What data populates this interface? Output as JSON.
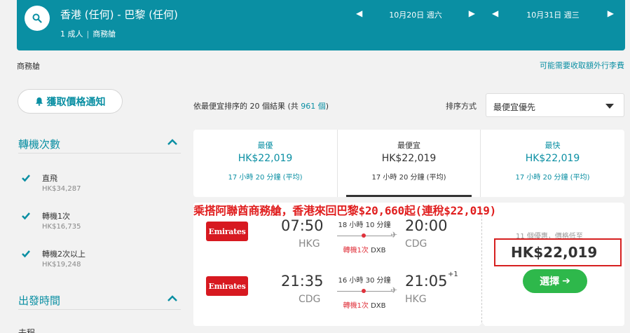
{
  "search": {
    "route": "香港 (任何) - 巴黎 (任何)",
    "passengers": "1 成人",
    "cabin": "商務艙",
    "depart_date": "10月20日 週六",
    "return_date": "10月31日 週三"
  },
  "subheader": {
    "cabin_label": "商務艙",
    "baggage_link": "可能需要收取額外行李費"
  },
  "sidebar": {
    "alert_button": "獲取價格通知",
    "stops_title": "轉機次數",
    "stops": [
      {
        "label": "直飛",
        "price": "HK$34,287",
        "checked": true
      },
      {
        "label": "轉機1次",
        "price": "HK$16,735",
        "checked": true
      },
      {
        "label": "轉機2次以上",
        "price": "HK$19,248",
        "checked": true
      }
    ],
    "departure_title": "出發時間",
    "cut_label": "去程"
  },
  "results": {
    "count_prefix": "依最便宜排序的 20 個結果 (共 ",
    "count_total": "961 個",
    "count_suffix": ")",
    "sort_label": "排序方式",
    "sort_value": "最便宜優先"
  },
  "summary": [
    {
      "title": "最優",
      "price": "HK$22,019",
      "duration": "17 小時 20 分鐘 (平均)"
    },
    {
      "title": "最便宜",
      "price": "HK$22,019",
      "duration": "17 小時 20 分鐘 (平均)"
    },
    {
      "title": "最快",
      "price": "HK$22,019",
      "duration": "17 小時 20 分鐘 (平均)"
    }
  ],
  "promo_banner": "乘搭阿聯酋商務艙，香港來回巴黎$20,660起(連稅$22,019)",
  "card": {
    "airline": "Emirates",
    "outbound": {
      "dep_time": "07:50",
      "dep_airport": "HKG",
      "arr_time": "20:00",
      "arr_airport": "CDG",
      "duration": "18 小時 10 分鐘",
      "stops": "轉機1次",
      "via": "DXB"
    },
    "inbound": {
      "dep_time": "21:35",
      "dep_airport": "CDG",
      "arr_time": "21:05",
      "arr_airport": "HKG",
      "day_offset": "+1",
      "duration": "16 小時 30 分鐘",
      "stops": "轉機1次",
      "via": "DXB"
    },
    "deals_text": "11 個優惠，價格低至",
    "price": "HK$22,019",
    "select_button": "選擇"
  },
  "colors": {
    "brand": "#0a8fa3",
    "highlight": "#d62020",
    "select": "#2eb84b",
    "airline": "#d71920"
  }
}
